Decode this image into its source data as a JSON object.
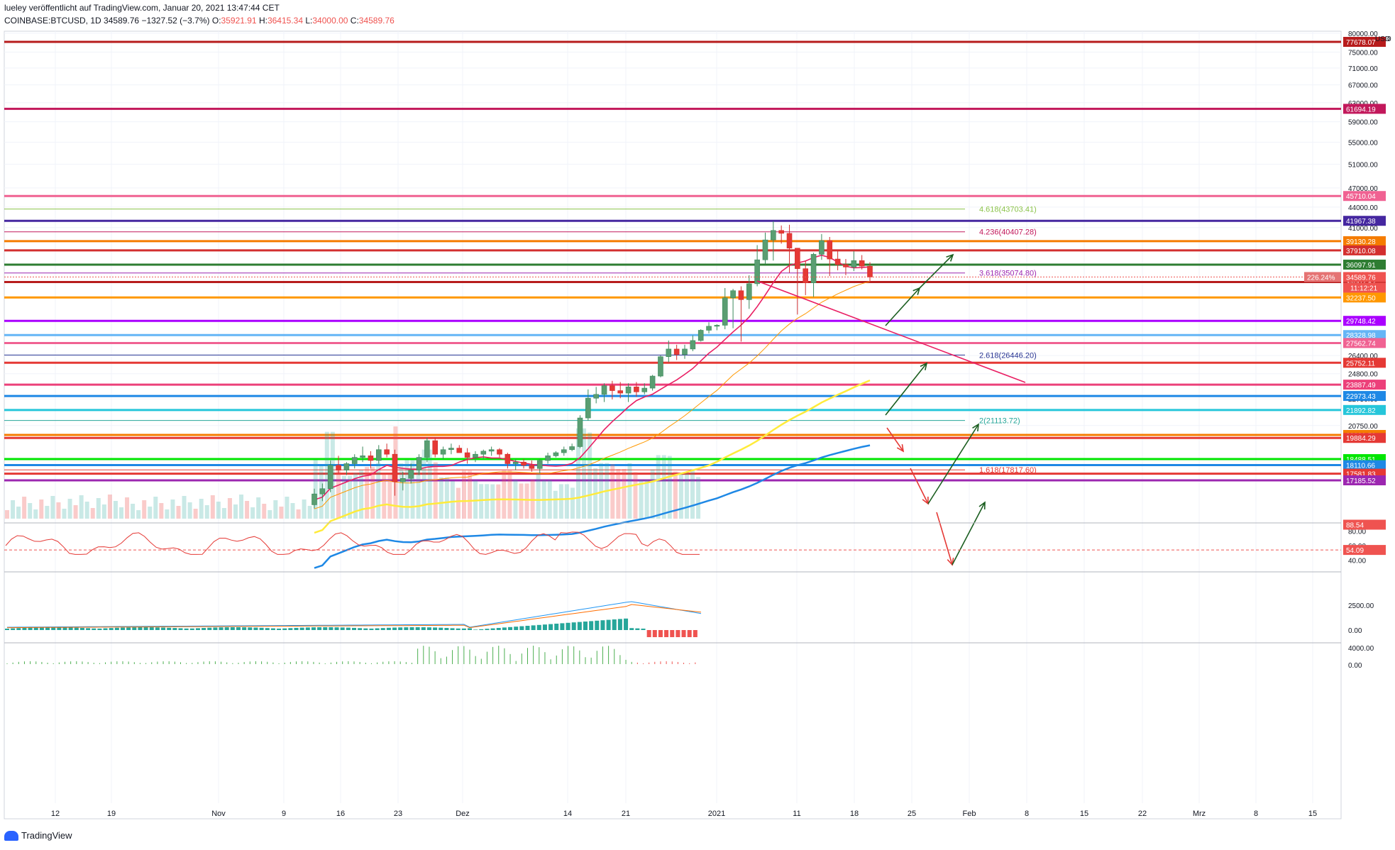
{
  "header": {
    "publisher": "lueley veröffentlicht auf TradingView.com, Januar 20, 2021 13:47:44 CET",
    "symbol": "COINBASE:BTCUSD, 1D",
    "last": "34589.76",
    "change": "−1327.52 (−3.7%)",
    "o_label": "O:",
    "o_value": "35921.91",
    "h_label": "H:",
    "h_value": "36415.34",
    "l_label": "L:",
    "l_value": "34000.00",
    "c_label": "C:",
    "c_value": "34589.76"
  },
  "footer": {
    "brand": "TradingView"
  },
  "scale_header": {
    "currency": "USD",
    "zero": "0"
  },
  "colors": {
    "up": "#26a69a",
    "down": "#ef5350",
    "text": "#131722",
    "grid": "#f0f3fa",
    "pink_trend": "#e91e63",
    "arrow_green": "#1b5e20",
    "arrow_red": "#e53935"
  },
  "chart_data": {
    "type": "line",
    "title": "",
    "x_ticks": [
      "12",
      "19",
      "Nov",
      "9",
      "16",
      "23",
      "Dez",
      "14",
      "21",
      "2021",
      "11",
      "18",
      "25",
      "Feb",
      "8",
      "15",
      "22",
      "Mrz",
      "8",
      "15"
    ],
    "y_ticks": [
      80000,
      75000,
      71000,
      67000,
      63000,
      59000,
      55000,
      51000,
      47000,
      44000,
      41000,
      38000,
      26400,
      24800,
      22750,
      20750
    ],
    "y_scale": "log",
    "last_price": 34589.76,
    "last_change_pct": "226.24%",
    "countdown": "11:12:21",
    "horizontal_levels": [
      {
        "value": 77678.07,
        "label": "77678.07",
        "color": "#b71c1c"
      },
      {
        "value": 61694.19,
        "label": "61694.19",
        "color": "#c2185b"
      },
      {
        "value": 45710.04,
        "label": "45710.04",
        "color": "#f06292"
      },
      {
        "value": 41967.38,
        "label": "41967.38",
        "color": "#4527a0"
      },
      {
        "value": 39130.28,
        "label": "39130.28",
        "color": "#f57c00"
      },
      {
        "value": 37910.08,
        "label": "37910.08",
        "color": "#d32f2f"
      },
      {
        "value": 36097.91,
        "label": "36097.91",
        "color": "#2e7d32"
      },
      {
        "value": 34002.82,
        "label": "34002.82",
        "color": "#b71c1c"
      },
      {
        "value": 32237.5,
        "label": "32237.50",
        "color": "#ff9800"
      },
      {
        "value": 29748.42,
        "label": "29748.42",
        "color": "#aa00ff"
      },
      {
        "value": 28328.98,
        "label": "28328.98",
        "color": "#64b5f6"
      },
      {
        "value": 27562.74,
        "label": "27562.74",
        "color": "#f06292"
      },
      {
        "value": 25752.11,
        "label": "25752.11",
        "color": "#e53935"
      },
      {
        "value": 23887.49,
        "label": "23887.49",
        "color": "#ec407a"
      },
      {
        "value": 22973.43,
        "label": "22973.43",
        "color": "#1e88e5"
      },
      {
        "value": 21892.82,
        "label": "21892.82",
        "color": "#26c6da"
      },
      {
        "value": 20089.53,
        "label": "20089.53",
        "color": "#f57c00"
      },
      {
        "value": 19884.29,
        "label": "19884.29",
        "color": "#e53935"
      },
      {
        "value": 18488.51,
        "label": "18488.51",
        "color": "#00e600"
      },
      {
        "value": 18110.66,
        "label": "18110.66",
        "color": "#1e88e5"
      },
      {
        "value": 17581.83,
        "label": "17581.83",
        "color": "#e53935"
      },
      {
        "value": 17185.52,
        "label": "17185.52",
        "color": "#9c27b0"
      }
    ],
    "fib_levels": [
      {
        "ratio": "4.618",
        "value": 43703.41,
        "label": "4.618(43703.41)",
        "color": "#8bc34a"
      },
      {
        "ratio": "4.236",
        "value": 40407.28,
        "label": "4.236(40407.28)",
        "color": "#c2185b"
      },
      {
        "ratio": "3.618",
        "value": 35074.8,
        "label": "3.618(35074.80)",
        "color": "#9c27b0"
      },
      {
        "ratio": "2.618",
        "value": 26446.2,
        "label": "2.618(26446.20)",
        "color": "#283593"
      },
      {
        "ratio": "2",
        "value": 21113.72,
        "label": "2(21113.72)",
        "color": "#26a69a"
      },
      {
        "ratio": "1.618",
        "value": 17817.6,
        "label": "1.618(17817.60)",
        "color": "#e53935"
      }
    ],
    "candles": [
      {
        "o": 15800,
        "h": 16700,
        "l": 15600,
        "c": 16400
      },
      {
        "o": 16400,
        "h": 17000,
        "l": 16000,
        "c": 16700
      },
      {
        "o": 16700,
        "h": 18400,
        "l": 16500,
        "c": 18100
      },
      {
        "o": 18100,
        "h": 18700,
        "l": 17600,
        "c": 17800
      },
      {
        "o": 17800,
        "h": 18300,
        "l": 17500,
        "c": 18200
      },
      {
        "o": 18200,
        "h": 18800,
        "l": 17900,
        "c": 18600
      },
      {
        "o": 18600,
        "h": 19300,
        "l": 18300,
        "c": 18700
      },
      {
        "o": 18700,
        "h": 19000,
        "l": 17900,
        "c": 18400
      },
      {
        "o": 18400,
        "h": 19400,
        "l": 18200,
        "c": 19100
      },
      {
        "o": 19100,
        "h": 19500,
        "l": 18600,
        "c": 18800
      },
      {
        "o": 18800,
        "h": 19100,
        "l": 16300,
        "c": 17100
      },
      {
        "o": 17100,
        "h": 17700,
        "l": 16600,
        "c": 17300
      },
      {
        "o": 17300,
        "h": 18200,
        "l": 17000,
        "c": 17800
      },
      {
        "o": 17800,
        "h": 18800,
        "l": 17500,
        "c": 18600
      },
      {
        "o": 18600,
        "h": 19900,
        "l": 18300,
        "c": 19700
      },
      {
        "o": 19700,
        "h": 19900,
        "l": 18600,
        "c": 18800
      },
      {
        "o": 18800,
        "h": 19300,
        "l": 18500,
        "c": 19100
      },
      {
        "o": 19100,
        "h": 19500,
        "l": 18800,
        "c": 19200
      },
      {
        "o": 19200,
        "h": 19400,
        "l": 18900,
        "c": 18900
      },
      {
        "o": 18900,
        "h": 19200,
        "l": 18200,
        "c": 18600
      },
      {
        "o": 18600,
        "h": 19000,
        "l": 18300,
        "c": 18800
      },
      {
        "o": 18800,
        "h": 19100,
        "l": 18500,
        "c": 19000
      },
      {
        "o": 19000,
        "h": 19300,
        "l": 18700,
        "c": 19100
      },
      {
        "o": 19100,
        "h": 19200,
        "l": 18600,
        "c": 18800
      },
      {
        "o": 18800,
        "h": 18900,
        "l": 17900,
        "c": 18200
      },
      {
        "o": 18200,
        "h": 18500,
        "l": 17800,
        "c": 18300
      },
      {
        "o": 18300,
        "h": 18500,
        "l": 17900,
        "c": 18100
      },
      {
        "o": 18100,
        "h": 18400,
        "l": 17700,
        "c": 17900
      },
      {
        "o": 17900,
        "h": 18500,
        "l": 17600,
        "c": 18400
      },
      {
        "o": 18400,
        "h": 18900,
        "l": 18200,
        "c": 18700
      },
      {
        "o": 18700,
        "h": 19000,
        "l": 18600,
        "c": 18900
      },
      {
        "o": 18900,
        "h": 19300,
        "l": 18700,
        "c": 19100
      },
      {
        "o": 19100,
        "h": 19500,
        "l": 19000,
        "c": 19300
      },
      {
        "o": 19300,
        "h": 21500,
        "l": 19200,
        "c": 21300
      },
      {
        "o": 21300,
        "h": 23500,
        "l": 21100,
        "c": 22800
      },
      {
        "o": 22800,
        "h": 23700,
        "l": 22400,
        "c": 23100
      },
      {
        "o": 23100,
        "h": 24000,
        "l": 22500,
        "c": 23800
      },
      {
        "o": 23800,
        "h": 24200,
        "l": 22700,
        "c": 23400
      },
      {
        "o": 23400,
        "h": 24100,
        "l": 22800,
        "c": 23200
      },
      {
        "o": 23200,
        "h": 24000,
        "l": 22500,
        "c": 23700
      },
      {
        "o": 23700,
        "h": 24100,
        "l": 22900,
        "c": 23300
      },
      {
        "o": 23300,
        "h": 24000,
        "l": 23100,
        "c": 23600
      },
      {
        "o": 23600,
        "h": 24700,
        "l": 23400,
        "c": 24600
      },
      {
        "o": 24600,
        "h": 26400,
        "l": 24500,
        "c": 26300
      },
      {
        "o": 26300,
        "h": 27800,
        "l": 25800,
        "c": 27000
      },
      {
        "o": 27000,
        "h": 27400,
        "l": 26000,
        "c": 26500
      },
      {
        "o": 26500,
        "h": 27400,
        "l": 26100,
        "c": 27000
      },
      {
        "o": 27000,
        "h": 28300,
        "l": 26800,
        "c": 27800
      },
      {
        "o": 27800,
        "h": 28900,
        "l": 27700,
        "c": 28800
      },
      {
        "o": 28800,
        "h": 29600,
        "l": 28500,
        "c": 29200
      },
      {
        "o": 29200,
        "h": 29400,
        "l": 28800,
        "c": 29300
      },
      {
        "o": 29300,
        "h": 33300,
        "l": 28900,
        "c": 32200
      },
      {
        "o": 32200,
        "h": 33200,
        "l": 29000,
        "c": 33000
      },
      {
        "o": 33000,
        "h": 33500,
        "l": 27700,
        "c": 32000
      },
      {
        "o": 32000,
        "h": 34800,
        "l": 31000,
        "c": 33800
      },
      {
        "o": 33800,
        "h": 38600,
        "l": 33500,
        "c": 36700
      },
      {
        "o": 36700,
        "h": 40300,
        "l": 36200,
        "c": 39300
      },
      {
        "o": 39300,
        "h": 41900,
        "l": 36600,
        "c": 40600
      },
      {
        "o": 40600,
        "h": 41300,
        "l": 38800,
        "c": 40200
      },
      {
        "o": 40200,
        "h": 41400,
        "l": 35100,
        "c": 38200
      },
      {
        "o": 38200,
        "h": 38200,
        "l": 30400,
        "c": 35600
      },
      {
        "o": 35600,
        "h": 36600,
        "l": 32500,
        "c": 33900
      },
      {
        "o": 33900,
        "h": 37600,
        "l": 32300,
        "c": 37400
      },
      {
        "o": 37400,
        "h": 40100,
        "l": 36700,
        "c": 39200
      },
      {
        "o": 39200,
        "h": 39700,
        "l": 34700,
        "c": 36800
      },
      {
        "o": 36800,
        "h": 37900,
        "l": 35400,
        "c": 36100
      },
      {
        "o": 36100,
        "h": 36800,
        "l": 34800,
        "c": 35800
      },
      {
        "o": 35800,
        "h": 37800,
        "l": 35300,
        "c": 36600
      },
      {
        "o": 36600,
        "h": 37300,
        "l": 35500,
        "c": 35900
      },
      {
        "o": 35900,
        "h": 36400,
        "l": 34000,
        "c": 34590
      }
    ],
    "rsi_level": 54.09,
    "rsi_ticks": [
      80,
      60,
      40
    ],
    "rsi_top_label": "88.54",
    "macd_ticks": [
      "2500.00",
      "0.00"
    ],
    "third_ticks": [
      "4000.00",
      "0.00"
    ]
  }
}
